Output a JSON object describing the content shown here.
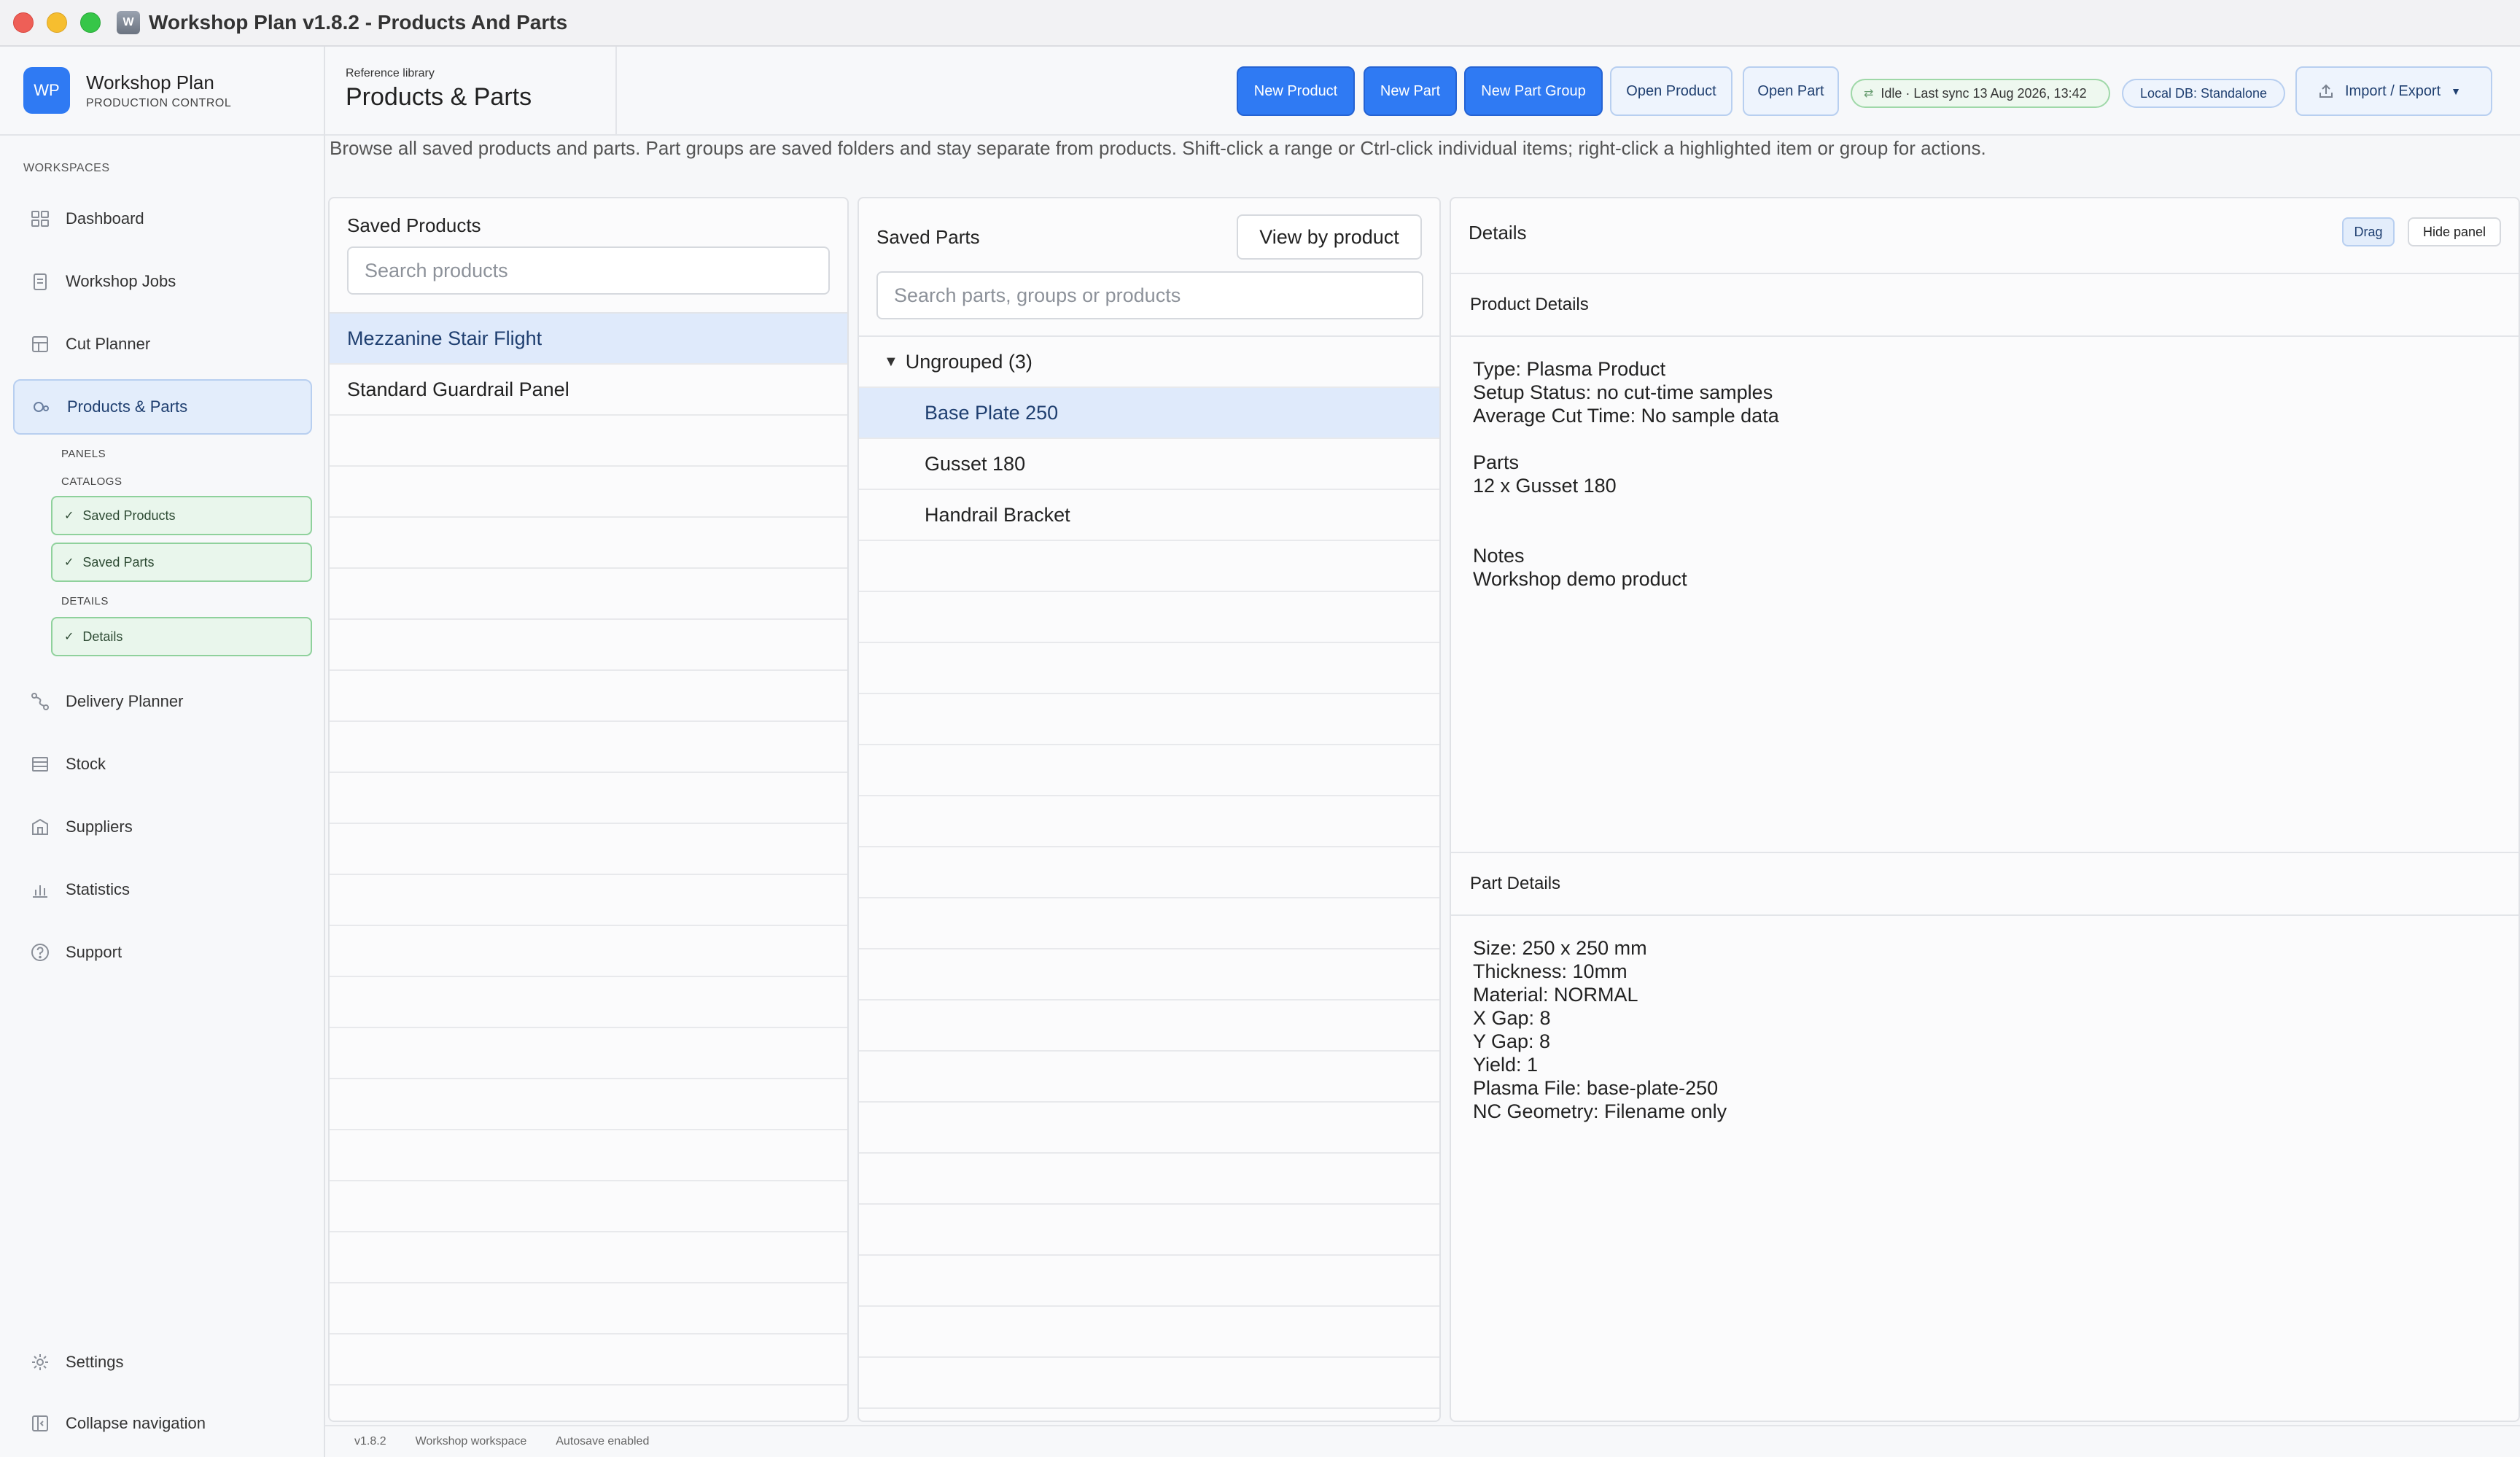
{
  "window": {
    "title": "Workshop Plan v1.8.2 - Products And Parts",
    "app_icon": "W"
  },
  "brand": {
    "logo": "WP",
    "name": "Workshop Plan",
    "subtitle": "PRODUCTION CONTROL"
  },
  "sidebar": {
    "section_label": "WORKSPACES",
    "items": [
      {
        "label": "Dashboard",
        "icon": "dashboard-icon"
      },
      {
        "label": "Workshop Jobs",
        "icon": "clipboard-icon"
      },
      {
        "label": "Cut Planner",
        "icon": "cut-planner-icon"
      },
      {
        "label": "Products & Parts",
        "icon": "parts-icon"
      },
      {
        "label": "Delivery Planner",
        "icon": "route-icon"
      },
      {
        "label": "Stock",
        "icon": "stock-icon"
      },
      {
        "label": "Suppliers",
        "icon": "building-icon"
      },
      {
        "label": "Statistics",
        "icon": "bar-chart-icon"
      },
      {
        "label": "Support",
        "icon": "help-icon"
      }
    ],
    "sub_labels": {
      "panels": "PANELS",
      "catalogs": "CATALOGS",
      "details": "DETAILS"
    },
    "sub_items": [
      "Saved Products",
      "Saved Parts",
      "Details"
    ],
    "settings_label": "Settings",
    "collapse_label": "Collapse navigation"
  },
  "header": {
    "eyebrow": "Reference library",
    "title": "Products & Parts",
    "buttons": {
      "new_product": "New Product",
      "new_part": "New Part",
      "new_part_group": "New Part Group",
      "open_product": "Open Product",
      "open_part": "Open Part"
    },
    "sync_status": "Idle · Last sync 13 Aug 2026, 13:42",
    "db_status": "Local DB: Standalone",
    "import_export": "Import / Export"
  },
  "description": "Browse all saved products and parts. Part groups are saved folders and stay separate from products. Shift-click a range or Ctrl-click individual items; right-click a highlighted item or group for actions.",
  "products_panel": {
    "title": "Saved Products",
    "search_placeholder": "Search products",
    "items": [
      "Mezzanine Stair Flight",
      "Standard Guardrail Panel"
    ],
    "selected": 0
  },
  "parts_panel": {
    "title": "Saved Parts",
    "view_button": "View by product",
    "search_placeholder": "Search parts, groups or products",
    "group_label": "Ungrouped (3)",
    "items": [
      "Base Plate 250",
      "Gusset 180",
      "Handrail Bracket"
    ],
    "selected": 0
  },
  "details_panel": {
    "title": "Details",
    "drag_label": "Drag",
    "hide_label": "Hide panel",
    "product_details_title": "Product Details",
    "product_lines": [
      "Type: Plasma Product",
      "Setup Status: no cut-time samples",
      "Average Cut Time: No sample data",
      "",
      "Parts",
      "12 x Gusset 180",
      "",
      "",
      "Notes",
      "Workshop demo product"
    ],
    "part_details_title": "Part Details",
    "part_lines": [
      "Size: 250 x 250 mm",
      "Thickness: 10mm",
      "Material: NORMAL",
      "X Gap: 8",
      "Y Gap: 8",
      "Yield: 1",
      "Plasma File: base-plate-250",
      "NC Geometry: Filename only"
    ]
  },
  "footer": {
    "version": "v1.8.2",
    "workspace": "Workshop workspace",
    "autosave": "Autosave enabled"
  }
}
